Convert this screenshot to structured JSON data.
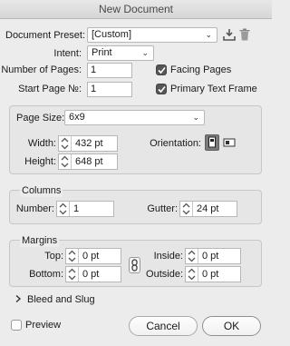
{
  "window": {
    "title": "New Document"
  },
  "preset": {
    "label": "Document Preset:",
    "value": "[Custom]",
    "icons": [
      "save-preset-icon",
      "delete-preset-icon"
    ]
  },
  "intent": {
    "label": "Intent:",
    "value": "Print"
  },
  "pages": {
    "label": "Number of Pages:",
    "value": "1"
  },
  "start_page": {
    "label": "Start Page №:",
    "value": "1"
  },
  "facing_pages": {
    "label": "Facing Pages",
    "checked": true
  },
  "primary_text_frame": {
    "label": "Primary Text Frame",
    "checked": true
  },
  "page_size": {
    "label": "Page Size:",
    "value": "6x9",
    "width_label": "Width:",
    "width": "432 pt",
    "height_label": "Height:",
    "height": "648 pt",
    "orientation_label": "Orientation:",
    "orientation_options": [
      "portrait-icon",
      "landscape-icon"
    ],
    "orientation_selected": "portrait-icon"
  },
  "columns": {
    "title": "Columns",
    "number_label": "Number:",
    "number": "1",
    "gutter_label": "Gutter:",
    "gutter": "24 pt"
  },
  "margins": {
    "title": "Margins",
    "top_label": "Top:",
    "top": "0 pt",
    "bottom_label": "Bottom:",
    "bottom": "0 pt",
    "inside_label": "Inside:",
    "inside": "0 pt",
    "outside_label": "Outside:",
    "outside": "0 pt",
    "link_icon": "chain-link-icon"
  },
  "bleed_slug": {
    "label": "Bleed and Slug",
    "expanded": false
  },
  "preview": {
    "label": "Preview",
    "checked": false
  },
  "buttons": {
    "cancel": "Cancel",
    "ok": "OK"
  }
}
